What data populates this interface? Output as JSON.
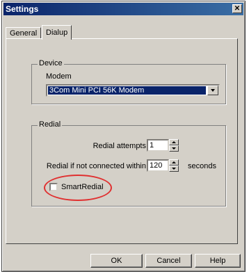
{
  "window": {
    "title": "Settings",
    "close_glyph": "✕"
  },
  "tabs": [
    {
      "label": "General",
      "active": false
    },
    {
      "label": "Dialup",
      "active": true
    }
  ],
  "device": {
    "group_label": "Device",
    "modem_label": "Modem",
    "modem_selected": "3Com Mini PCI 56K Modem"
  },
  "redial": {
    "group_label": "Redial",
    "attempts_label": "Redial attempts",
    "attempts_value": "1",
    "timeout_label": "Redial if not connected within",
    "timeout_value": "120",
    "timeout_unit": "seconds",
    "smartredial_label": "SmartRedial",
    "smartredial_checked": false
  },
  "buttons": {
    "ok": "OK",
    "cancel": "Cancel",
    "help": "Help"
  },
  "colors": {
    "highlight": "#e03030",
    "titlebar": "#0a246a"
  },
  "icons": [
    "close-icon",
    "dropdown-arrow-icon",
    "spin-up-icon",
    "spin-down-icon"
  ]
}
